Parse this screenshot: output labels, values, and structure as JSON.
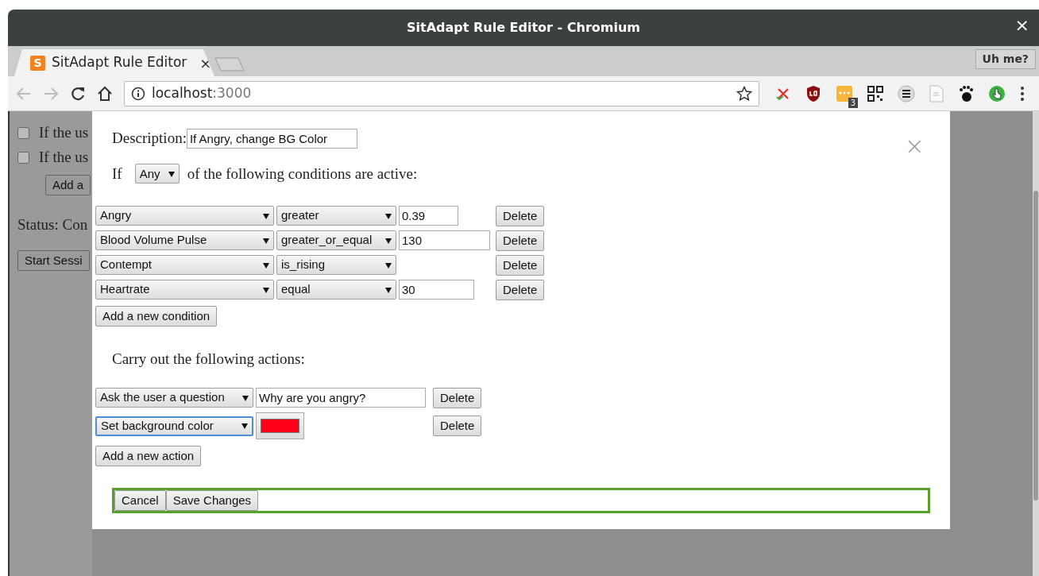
{
  "window": {
    "title": "SitAdapt Rule Editor - Chromium",
    "close": "×"
  },
  "tabs": [
    {
      "label": "SitAdapt Rule Editor",
      "favicon": "S",
      "selected": true,
      "close": "×"
    }
  ],
  "profile_button": "Uh me?",
  "toolbar": {
    "back_disabled": true,
    "forward_disabled": true,
    "url_host": "localhost",
    "url_port": ":3000",
    "bookmarked": false,
    "extension_badge": "3"
  },
  "background_page": {
    "rules": [
      {
        "label": "If the us",
        "checked": false
      },
      {
        "label": "If the us",
        "checked": false
      }
    ],
    "add_button": "Add a",
    "status": "Status: Con",
    "start_button": "Start Sessi"
  },
  "dialog": {
    "close": "×",
    "description_label": "Description:",
    "description_value": "If Angry, change BG Color",
    "if_label": "If",
    "match_select": "Any",
    "conditions_label": "of the following conditions are active:",
    "conditions": [
      {
        "field": "Angry",
        "operator": "greater",
        "value": "0.39",
        "delete": "Delete"
      },
      {
        "field": "Blood Volume Pulse",
        "operator": "greater_or_equal",
        "value": "130",
        "delete": "Delete"
      },
      {
        "field": "Contempt",
        "operator": "is_rising",
        "delete": "Delete"
      },
      {
        "field": "Heartrate",
        "operator": "equal",
        "value": "30",
        "delete": "Delete"
      }
    ],
    "add_condition": "Add a new condition",
    "actions_label": "Carry out the following actions:",
    "actions": [
      {
        "kind": "text",
        "action": "Ask the user a question",
        "value": "Why are you angry?",
        "focused": false,
        "delete": "Delete"
      },
      {
        "kind": "color",
        "action": "Set background color",
        "color": "#ff0018",
        "focused": true,
        "delete": "Delete"
      }
    ],
    "add_action": "Add a new action",
    "footer_buttons": [
      "Cancel",
      "Save Changes"
    ]
  }
}
